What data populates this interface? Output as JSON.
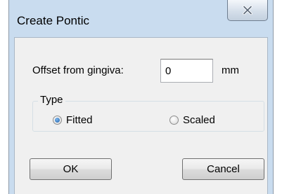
{
  "window": {
    "title": "Create Pontic"
  },
  "offset": {
    "label": "Offset from gingiva:",
    "value": "0",
    "unit": "mm"
  },
  "type_group": {
    "legend": "Type",
    "options": [
      {
        "label": "Fitted",
        "checked": true
      },
      {
        "label": "Scaled",
        "checked": false
      }
    ]
  },
  "buttons": {
    "ok_label": "OK",
    "cancel_label": "Cancel"
  },
  "icons": {
    "close": "close-icon"
  }
}
